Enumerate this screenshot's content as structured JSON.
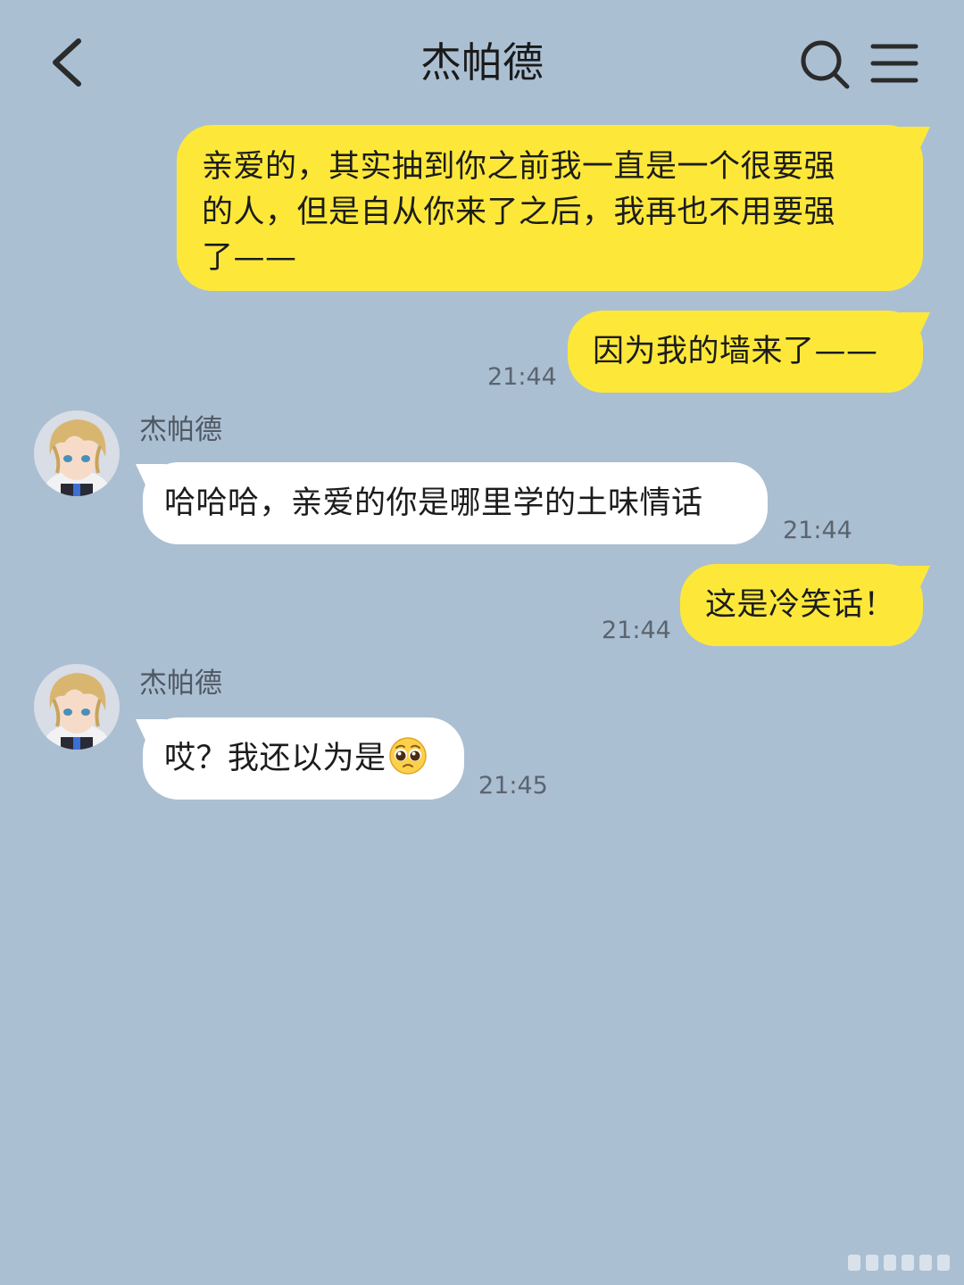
{
  "header": {
    "title": "杰帕德",
    "back_icon": "chevron-left-icon",
    "search_icon": "search-icon",
    "menu_icon": "hamburger-menu-icon"
  },
  "colors": {
    "background": "#abbfd2",
    "my_bubble": "#fde83a",
    "their_bubble": "#ffffff"
  },
  "messages": [
    {
      "sender": "me",
      "lines": [
        "亲爱的，其实抽到你之前我一直是一个很要强",
        "的人，但是自从你来了之后，我再也不用要强",
        "了——"
      ],
      "time": ""
    },
    {
      "sender": "me",
      "text": "因为我的墙来了——",
      "time": "21:44"
    },
    {
      "sender": "other",
      "name": "杰帕德",
      "text": "哈哈哈，亲爱的你是哪里学的土味情话",
      "time": "21:44"
    },
    {
      "sender": "me",
      "text": "这是冷笑话！",
      "time": "21:44"
    },
    {
      "sender": "other",
      "name": "杰帕德",
      "text": "哎？我还以为是",
      "emoji": "pleading-face-emoji",
      "time": "21:45"
    }
  ]
}
